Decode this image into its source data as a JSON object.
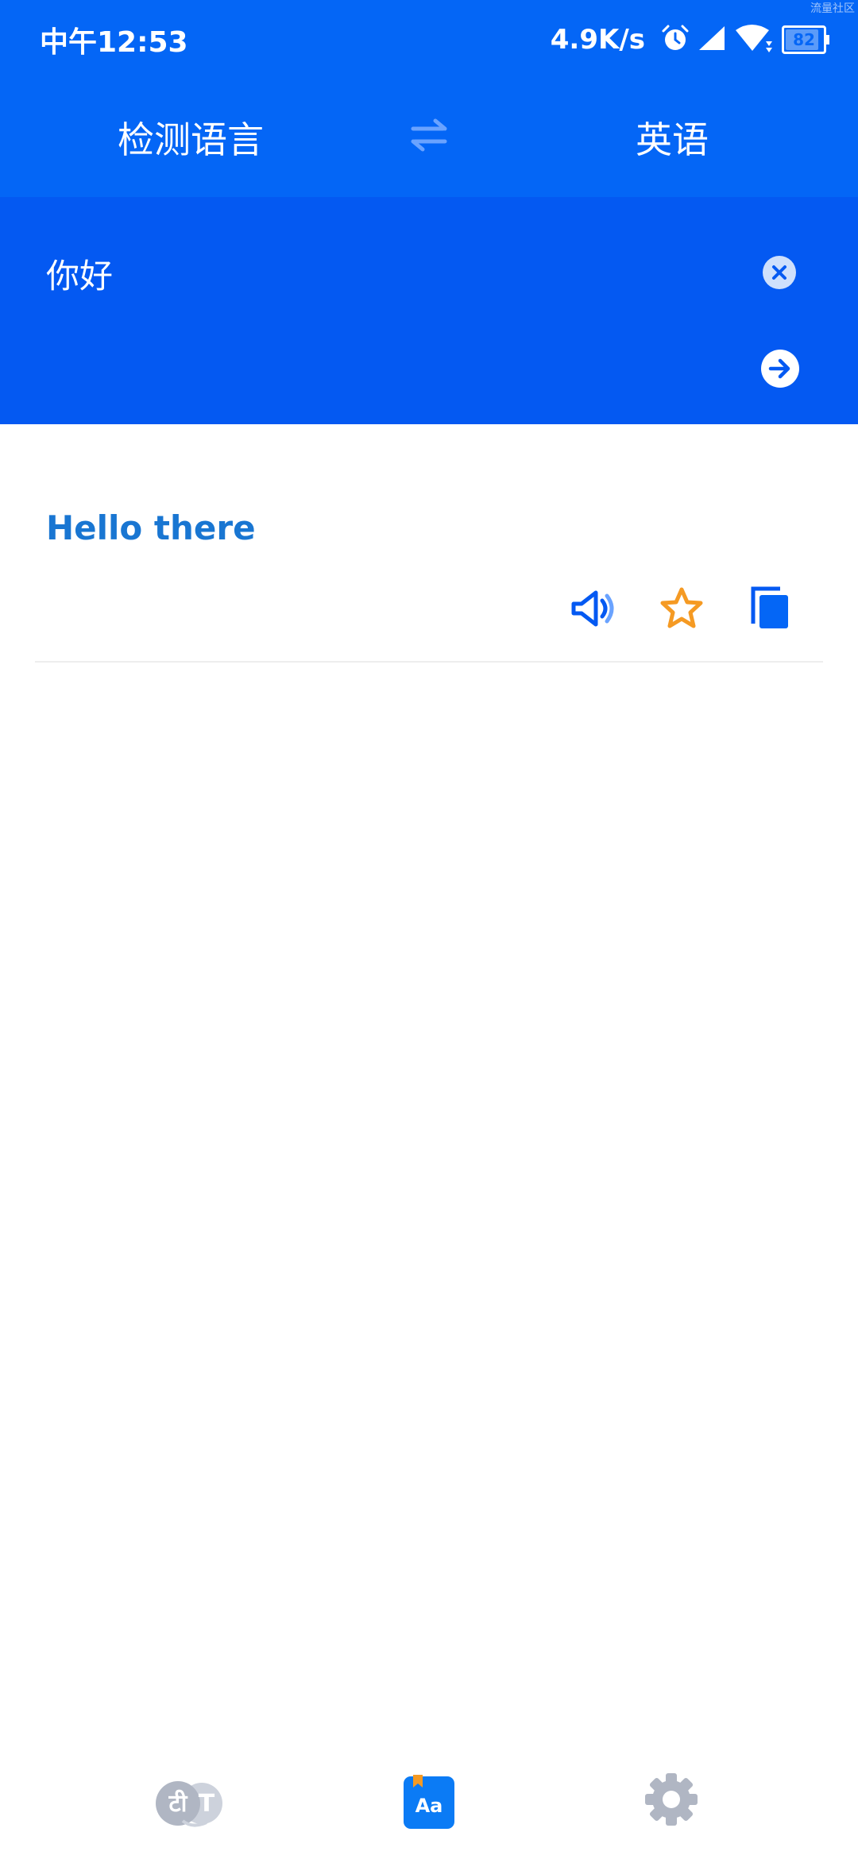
{
  "status_bar": {
    "time": "中午12:53",
    "net_speed": "4.9K/s",
    "battery": "82",
    "battery_level": 0.82,
    "icons": [
      "alarm-icon",
      "cellular-signal-icon",
      "wifi-icon",
      "battery-icon"
    ]
  },
  "watermark": "流量社区",
  "languages": {
    "source": "检测语言",
    "target": "英语",
    "swap_icon": "swap-arrows-icon"
  },
  "input": {
    "text": "你好",
    "clear_icon": "clear-circle-icon",
    "submit_icon": "arrow-right-circle-icon"
  },
  "result": {
    "text": "Hello there",
    "actions": [
      "speaker-icon",
      "star-icon",
      "copy-icon"
    ]
  },
  "bottom_nav": {
    "items": [
      {
        "name": "translate-tab",
        "icon": "translate-icon",
        "glyph_a": "टी",
        "glyph_b": "T"
      },
      {
        "name": "phrasebook-tab",
        "icon": "dictionary-icon",
        "glyph": "Aa",
        "selected": true
      },
      {
        "name": "settings-tab",
        "icon": "gear-icon"
      }
    ]
  },
  "colors": {
    "header_blue": "#0466f6",
    "input_blue": "#0459f2",
    "result_blue": "#1976d2",
    "star_orange": "#f59a23",
    "nav_gray": "#b0b6c3"
  }
}
